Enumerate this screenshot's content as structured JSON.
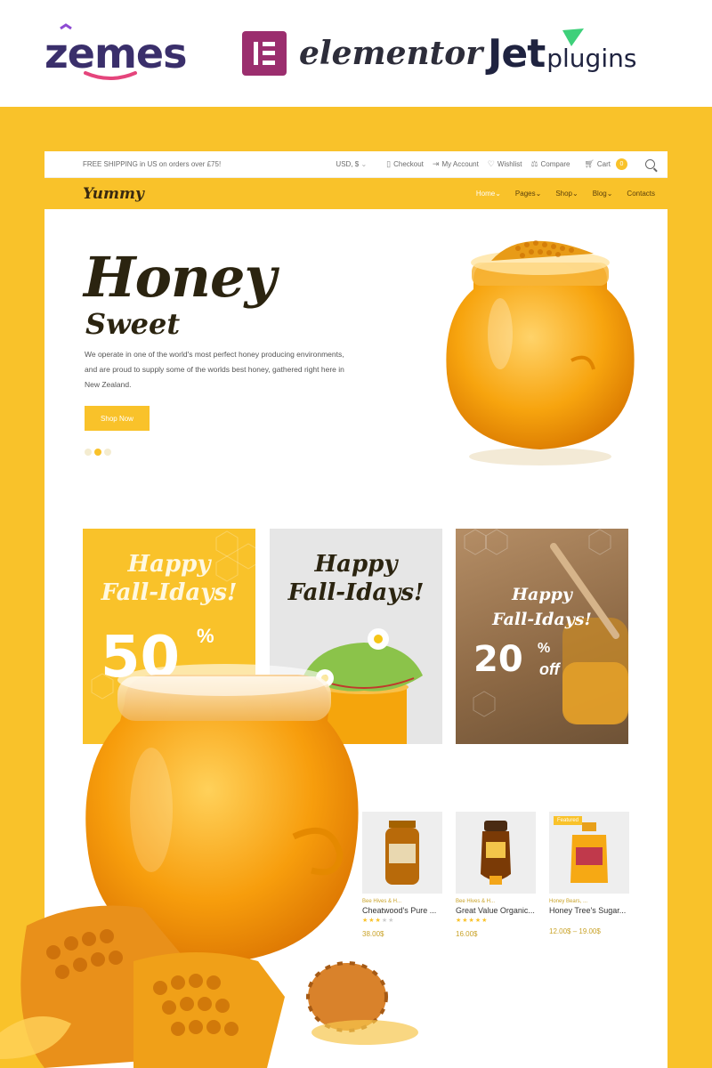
{
  "brands": {
    "zemes": "zemes",
    "elementor": "elementor",
    "jet": "Jet",
    "plugins": "plugins"
  },
  "colors": {
    "accent": "#f9c22a",
    "dark": "#2b2410",
    "honey": "#f7a40e"
  },
  "topbar": {
    "shipping": "FREE SHIPPING in US on orders over £75!",
    "currency": "USD, $",
    "checkout": "Checkout",
    "account": "My Account",
    "wishlist": "Wishlist",
    "compare": "Compare",
    "cart": "Cart",
    "cart_count": "0"
  },
  "nav": {
    "logo": "Yummy",
    "items": [
      {
        "label": "Home"
      },
      {
        "label": "Pages"
      },
      {
        "label": "Shop"
      },
      {
        "label": "Blog"
      },
      {
        "label": "Contacts"
      }
    ]
  },
  "hero": {
    "title": "Honey",
    "subtitle": "Sweet",
    "text": "We operate in one of the world's most perfect honey producing environments, and are proud to supply some of the worlds best honey, gathered right here in New Zealand.",
    "button": "Shop Now",
    "slide_count": 3,
    "active_slide": 2
  },
  "banners": [
    {
      "title_1": "Happy",
      "title_2": "Fall-Idays!",
      "discount": "50",
      "unit": "%"
    },
    {
      "title_1": "Happy",
      "title_2": "Fall-Idays!"
    },
    {
      "title_1": "Happy",
      "title_2": "Fall-Idays!",
      "discount": "20",
      "unit": "%",
      "suffix": "off"
    }
  ],
  "products": [
    {
      "category": "Bee Hives & H...",
      "name": "Cheatwood's Pure ...",
      "price": "38.00$",
      "rating": 3
    },
    {
      "category": "Bee Hives & H...",
      "name": "Great Value Organic...",
      "price": "16.00$",
      "rating": 5
    },
    {
      "category": "Honey Bears, ...",
      "name": "Honey Tree's Sugar...",
      "price": "12.00$ – 19.00$",
      "badge": "Featured"
    }
  ]
}
